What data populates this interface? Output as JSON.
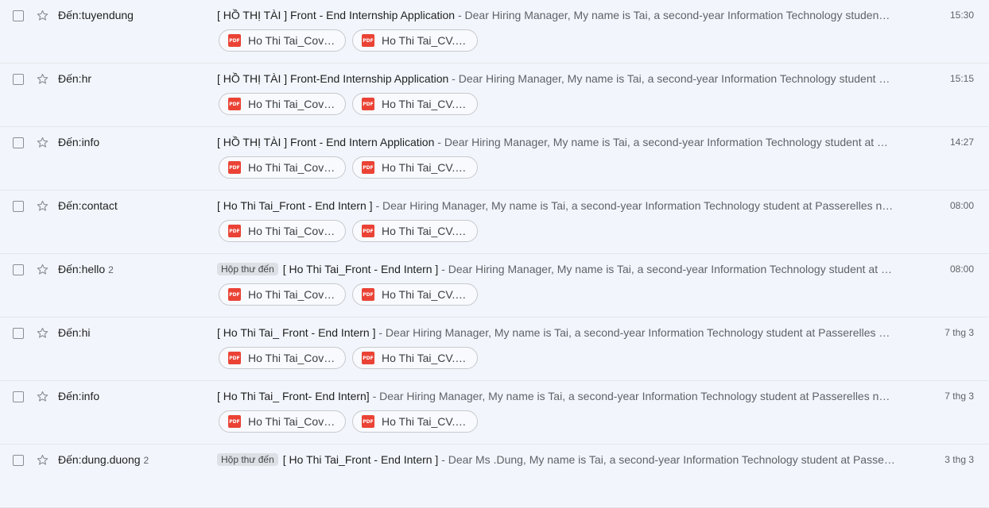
{
  "pdf_icon_text": "PDF",
  "colors": {
    "background": "#f2f6fc",
    "pdf_icon": "#ea4335",
    "label_chip": "#dde1e6"
  },
  "emails": [
    {
      "sender": "Đến:tuyendung",
      "count": "",
      "label": "",
      "subject": "[ HỒ THỊ TÀI ] Front - End Internship Application",
      "snippet": "Dear Hiring Manager, My name is Tai, a second-year Information Technology studen…",
      "time": "15:30",
      "attachments": [
        "Ho Thi Tai_Cove…",
        "Ho Thi Tai_CV.pdf"
      ]
    },
    {
      "sender": "Đến:hr",
      "count": "",
      "label": "",
      "subject": "[ HỒ THỊ TÀI ] Front-End Internship Application",
      "snippet": "Dear Hiring Manager, My name is Tai, a second-year Information Technology student …",
      "time": "15:15",
      "attachments": [
        "Ho Thi Tai_Cove…",
        "Ho Thi Tai_CV.pdf"
      ]
    },
    {
      "sender": "Đến:info",
      "count": "",
      "label": "",
      "subject": "[ HỒ THỊ TÀI ] Front - End Intern Application",
      "snippet": "Dear Hiring Manager, My name is Tai, a second-year Information Technology student at …",
      "time": "14:27",
      "attachments": [
        "Ho Thi Tai_Cove…",
        "Ho Thi Tai_CV.pdf"
      ]
    },
    {
      "sender": "Đến:contact",
      "count": "",
      "label": "",
      "subject": "[ Ho Thi Tai_Front - End Intern ]",
      "snippet": "Dear Hiring Manager, My name is Tai, a second-year Information Technology student at Passerelles n…",
      "time": "08:00",
      "attachments": [
        "Ho Thi Tai_Cove…",
        "Ho Thi Tai_CV.P…"
      ]
    },
    {
      "sender": "Đến:hello",
      "count": "2",
      "label": "Hộp thư đến",
      "subject": "[ Ho Thi Tai_Front - End Intern ]",
      "snippet": "Dear Hiring Manager, My name is Tai, a second-year Information Technology student at …",
      "time": "08:00",
      "attachments": [
        "Ho Thi Tai_Cove…",
        "Ho Thi Tai_CV.P…"
      ]
    },
    {
      "sender": "Đến:hi",
      "count": "",
      "label": "",
      "subject": "[ Ho Thi Tai_ Front - End Intern ]",
      "snippet": "Dear Hiring Manager, My name is Tai, a second-year Information Technology student at Passerelles …",
      "time": "7 thg 3",
      "attachments": [
        "Ho Thi Tai_Cove…",
        "Ho Thi Tai_CV.pdf"
      ]
    },
    {
      "sender": "Đến:info",
      "count": "",
      "label": "",
      "subject": "[ Ho Thi Tai_ Front- End Intern]",
      "snippet": "Dear Hiring Manager, My name is Tai, a second-year Information Technology student at Passerelles n…",
      "time": "7 thg 3",
      "attachments": [
        "Ho Thi Tai_Cove…",
        "Ho Thi Tai_CV.pdf"
      ]
    },
    {
      "sender": "Đến:dung.duong",
      "count": "2",
      "label": "Hộp thư đến",
      "subject": "[ Ho Thi Tai_Front - End Intern ]",
      "snippet": "Dear Ms .Dung, My name is Tai, a second-year Information Technology student at Passe…",
      "time": "3 thg 3",
      "attachments": []
    }
  ]
}
